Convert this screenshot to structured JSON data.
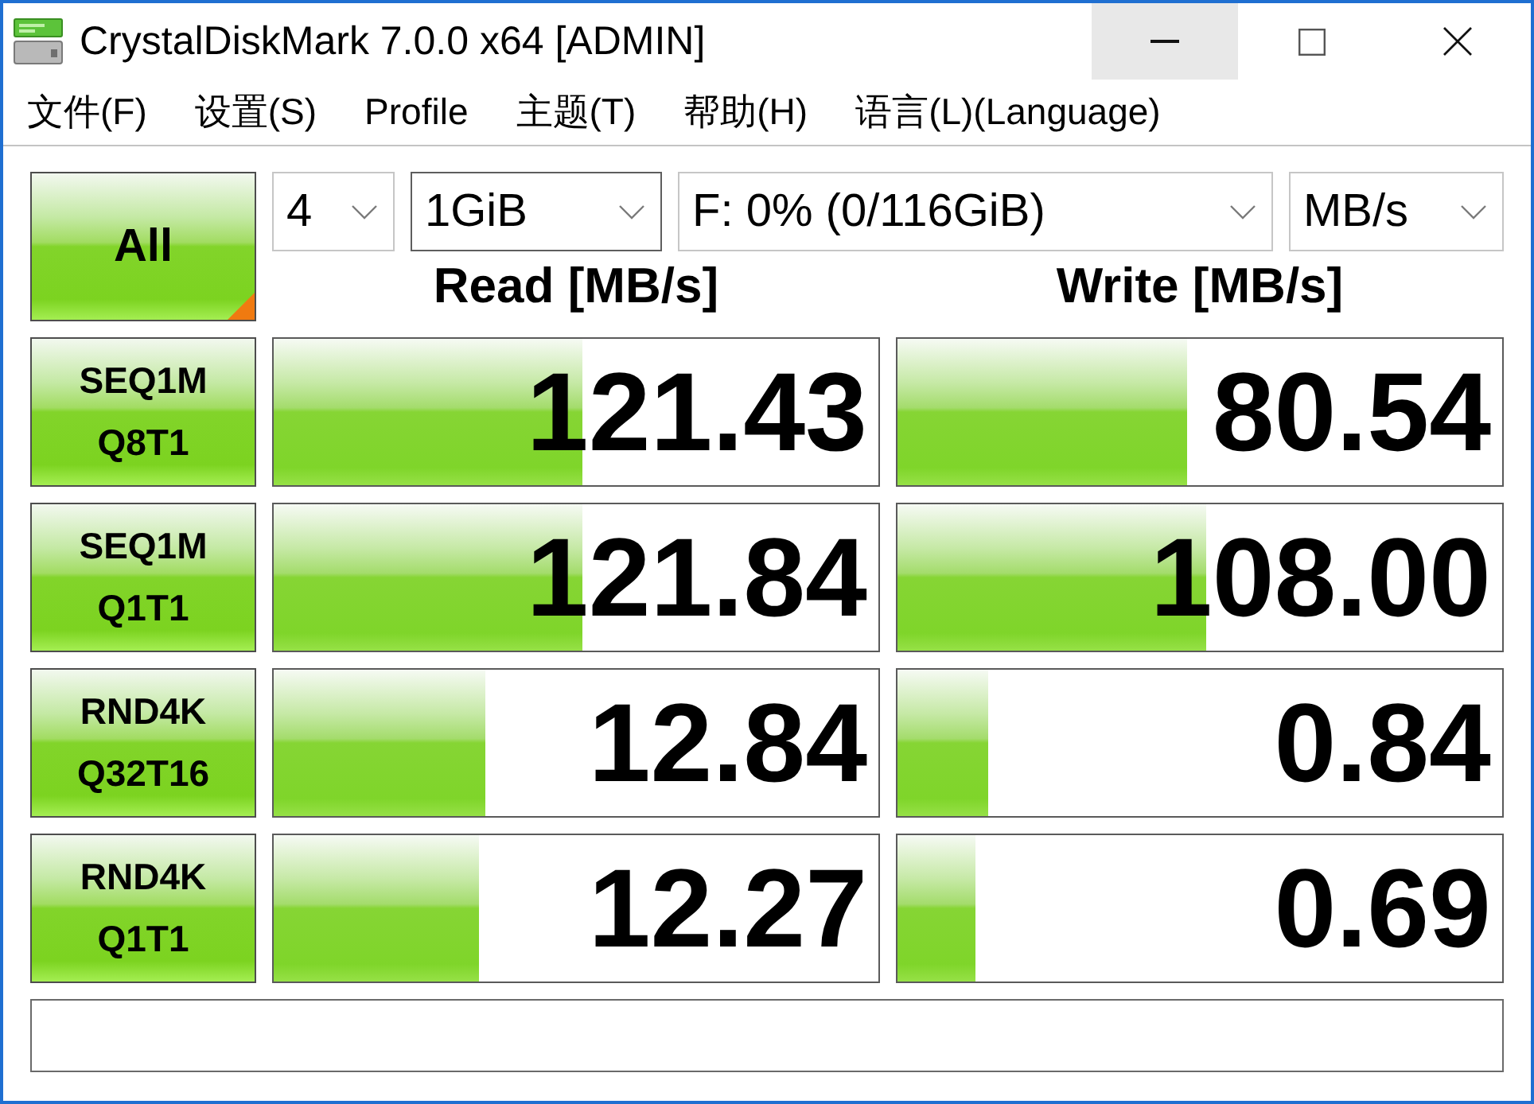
{
  "window": {
    "title": "CrystalDiskMark 7.0.0 x64 [ADMIN]",
    "controls": [
      {
        "kind": "minimize",
        "hovered": true
      },
      {
        "kind": "maximize",
        "hovered": false
      },
      {
        "kind": "close",
        "hovered": false
      }
    ]
  },
  "menu": [
    {
      "label": "文件(F)"
    },
    {
      "label": "设置(S)"
    },
    {
      "label": "Profile"
    },
    {
      "label": "主题(T)"
    },
    {
      "label": "帮助(H)"
    },
    {
      "label": "语言(L)(Language)"
    }
  ],
  "all_button": {
    "label": "All"
  },
  "selectors": [
    {
      "value": "4",
      "focused": false
    },
    {
      "value": "1GiB",
      "focused": true
    },
    {
      "value": "F: 0% (0/116GiB)",
      "focused": false
    },
    {
      "value": "MB/s",
      "focused": false
    }
  ],
  "columns": [
    {
      "label": "Read [MB/s]"
    },
    {
      "label": "Write [MB/s]"
    }
  ],
  "tests": [
    {
      "label_lines": [
        "SEQ1M",
        "Q8T1"
      ],
      "read": {
        "reading": "121.43",
        "level": 0.51
      },
      "write": {
        "reading": "80.54",
        "level": 0.48
      }
    },
    {
      "label_lines": [
        "SEQ1M",
        "Q1T1"
      ],
      "read": {
        "reading": "121.84",
        "level": 0.51
      },
      "write": {
        "reading": "108.00",
        "level": 0.51
      }
    },
    {
      "label_lines": [
        "RND4K",
        "Q32T16"
      ],
      "read": {
        "reading": "12.84",
        "level": 0.35
      },
      "write": {
        "reading": "0.84",
        "level": 0.15
      }
    },
    {
      "label_lines": [
        "RND4K",
        "Q1T1"
      ],
      "read": {
        "reading": "12.27",
        "level": 0.34
      },
      "write": {
        "reading": "0.69",
        "level": 0.13
      }
    }
  ]
}
